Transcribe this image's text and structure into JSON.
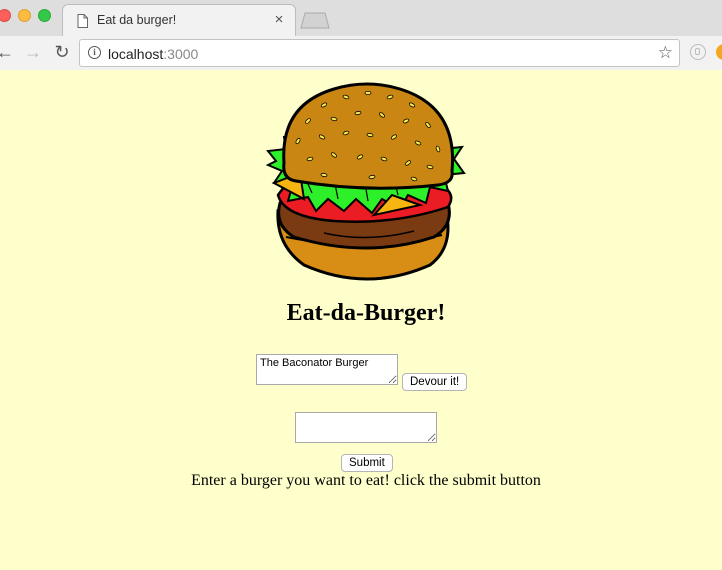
{
  "browser": {
    "tab_title": "Eat da burger!",
    "tab_close": "×",
    "url_host": "localhost",
    "url_port": ":3000"
  },
  "icons": {
    "star": "☆",
    "back": "←",
    "forward": "→",
    "reload": "↻",
    "info": "i"
  },
  "page": {
    "heading": "Eat-da-Burger!",
    "burgers": [
      {
        "name": "The Baconator Burger",
        "button_label": "Devour it!"
      }
    ],
    "new_burger": {
      "value": "",
      "submit_label": "Submit"
    },
    "instructions": "Enter a burger you want to eat! click the submit button"
  },
  "colors": {
    "page_background": "#ffffcc",
    "chrome_background": "#dedede"
  }
}
